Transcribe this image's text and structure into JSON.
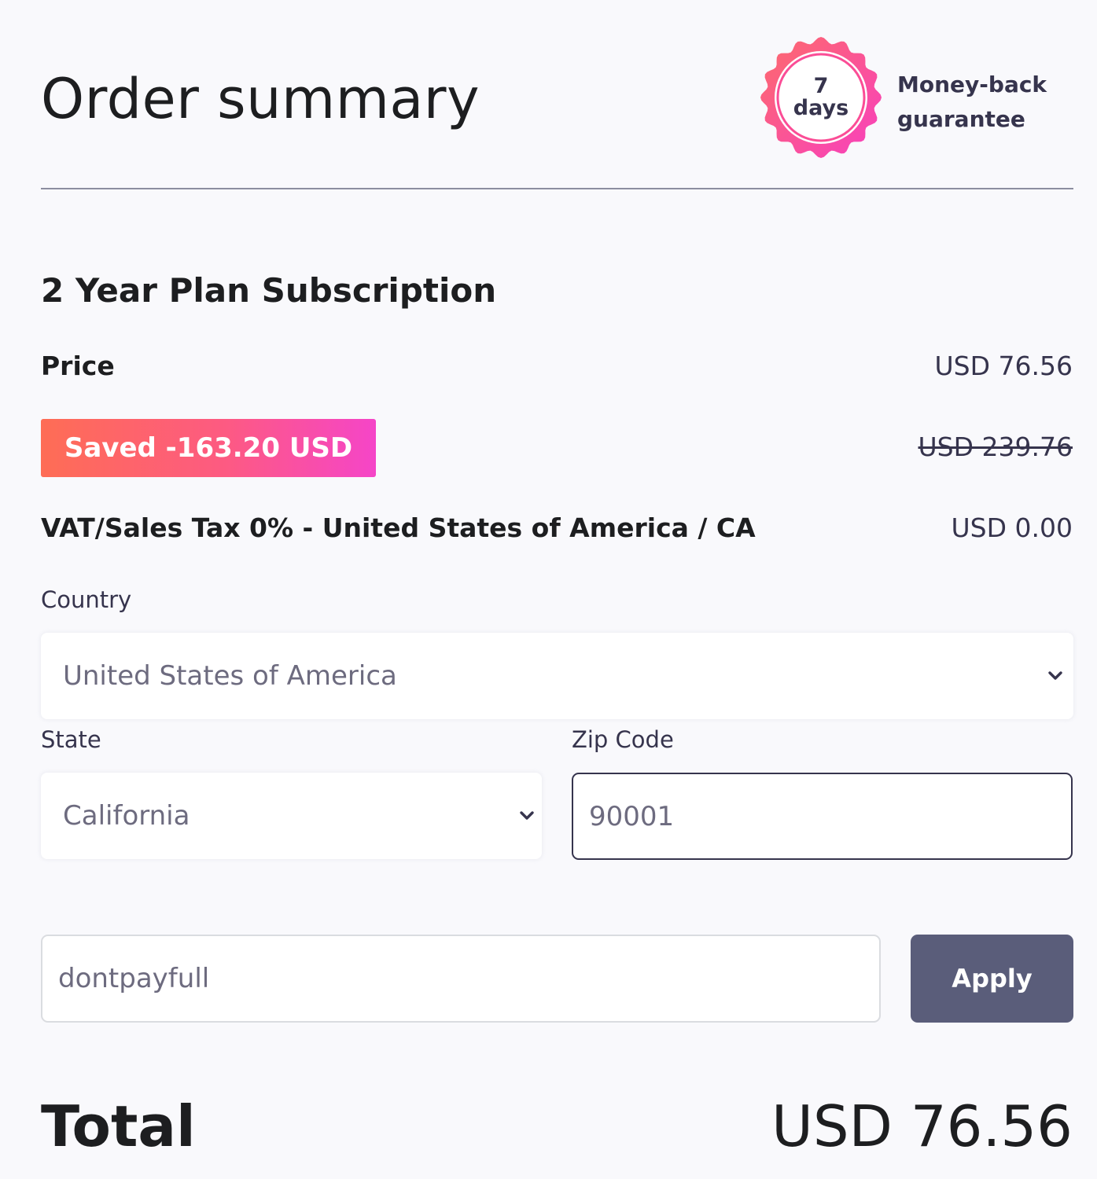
{
  "header": {
    "title": "Order summary",
    "badge": {
      "number": "7",
      "unit": "days",
      "icon": "seal-badge-icon",
      "color": "#fb4d96"
    },
    "guarantee_line1": "Money-back",
    "guarantee_line2": "guarantee"
  },
  "plan": {
    "name": "2 Year Plan Subscription",
    "price_label": "Price",
    "price_value": "USD 76.56",
    "saved_badge": "Saved -163.20 USD",
    "original_price": "USD 239.76",
    "tax_label": "VAT/Sales Tax 0% - United States of America / CA",
    "tax_value": "USD 0.00"
  },
  "form": {
    "country_label": "Country",
    "country_value": "United States of America",
    "state_label": "State",
    "state_value": "California",
    "zip_label": "Zip Code",
    "zip_value": "90001",
    "coupon_value": "dontpayfull",
    "apply_label": "Apply"
  },
  "total": {
    "label": "Total",
    "value": "USD 76.56"
  },
  "colors": {
    "accent_gradient_start": "#fe6d55",
    "accent_gradient_end": "#f545c8",
    "button": "#5a5d7a",
    "text_dark": "#1d1e20"
  }
}
